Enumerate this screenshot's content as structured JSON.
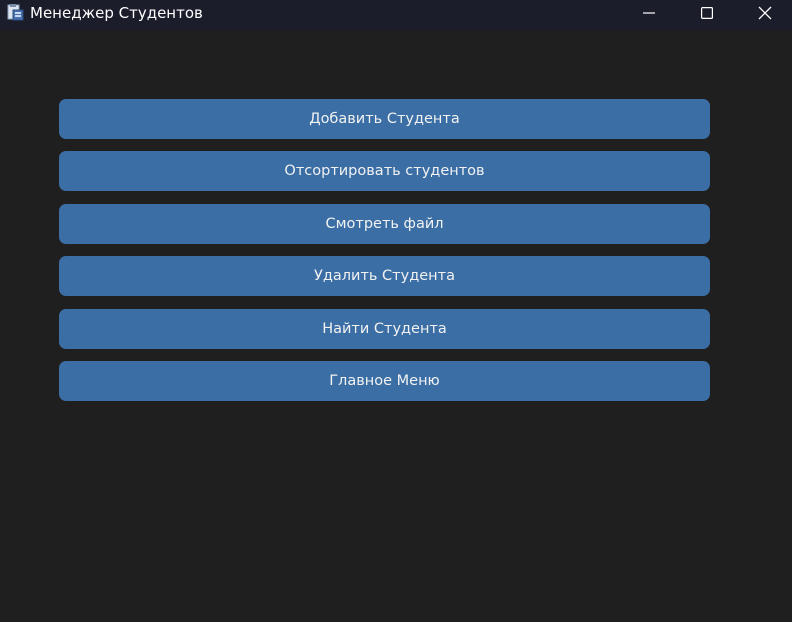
{
  "window": {
    "title": "Менеджер Студентов",
    "icon": "app-document-icon",
    "controls": {
      "minimize": "minimize-icon",
      "maximize": "maximize-icon",
      "close": "close-icon"
    }
  },
  "colors": {
    "background": "#1f1f1f",
    "titlebar": "#1c1d2b",
    "button": "#3a6ea5",
    "button_text": "#f2f2f2"
  },
  "menu": {
    "buttons": [
      {
        "label": "Добавить Студента"
      },
      {
        "label": "Отсортировать студентов"
      },
      {
        "label": "Смотреть файл"
      },
      {
        "label": "Удалить Студента"
      },
      {
        "label": "Найти Студента"
      },
      {
        "label": "Главное Меню"
      }
    ]
  }
}
